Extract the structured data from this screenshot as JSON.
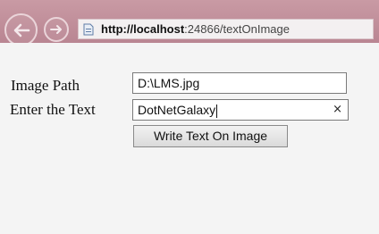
{
  "browser": {
    "url_host": "http://localhost",
    "url_rest": ":24866/textOnImage",
    "back_icon": "arrow-left-icon",
    "forward_icon": "arrow-right-icon",
    "page_icon": "page-icon"
  },
  "form": {
    "image_path_label": "Image Path",
    "image_path_value": "D:\\LMS.jpg",
    "text_label": "Enter the Text",
    "text_value": "DotNetGalaxy",
    "clear_icon": "close-icon",
    "clear_glyph": "×",
    "submit_label": "Write Text On Image"
  }
}
